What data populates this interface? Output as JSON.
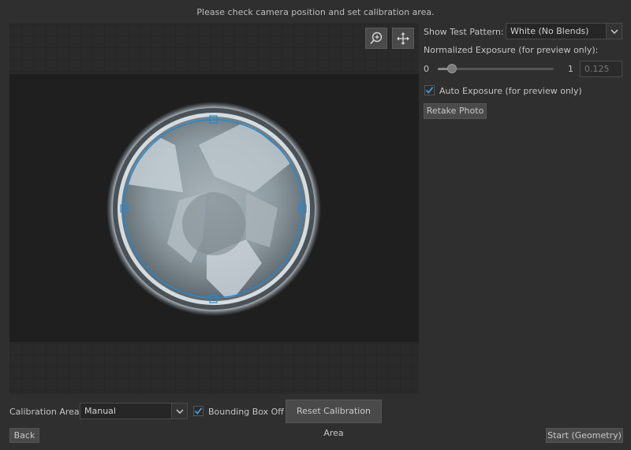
{
  "header": {
    "instruction": "Please check camera position and set calibration area."
  },
  "preview": {
    "zoom_tool": "zoom-in-icon",
    "pan_tool": "move-icon"
  },
  "test_pattern": {
    "label": "Show Test Pattern:",
    "selected": "White (No Blends)"
  },
  "exposure": {
    "label": "Normalized Exposure (for preview only):",
    "min_label": "0",
    "max_label": "1",
    "value": "0.125",
    "fraction": 0.125
  },
  "auto_exposure": {
    "label": "Auto Exposure (for preview only)",
    "checked": true
  },
  "retake_button": "Retake Photo",
  "calibration": {
    "label": "Calibration Area:",
    "selected": "Manual"
  },
  "bounding_box": {
    "label": "Bounding Box Off",
    "checked": true
  },
  "reset_button": "Reset Calibration Area",
  "back_button": "Back",
  "start_button": "Start (Geometry)",
  "colors": {
    "accent": "#1e8bd8",
    "background": "#2f2f2f"
  }
}
